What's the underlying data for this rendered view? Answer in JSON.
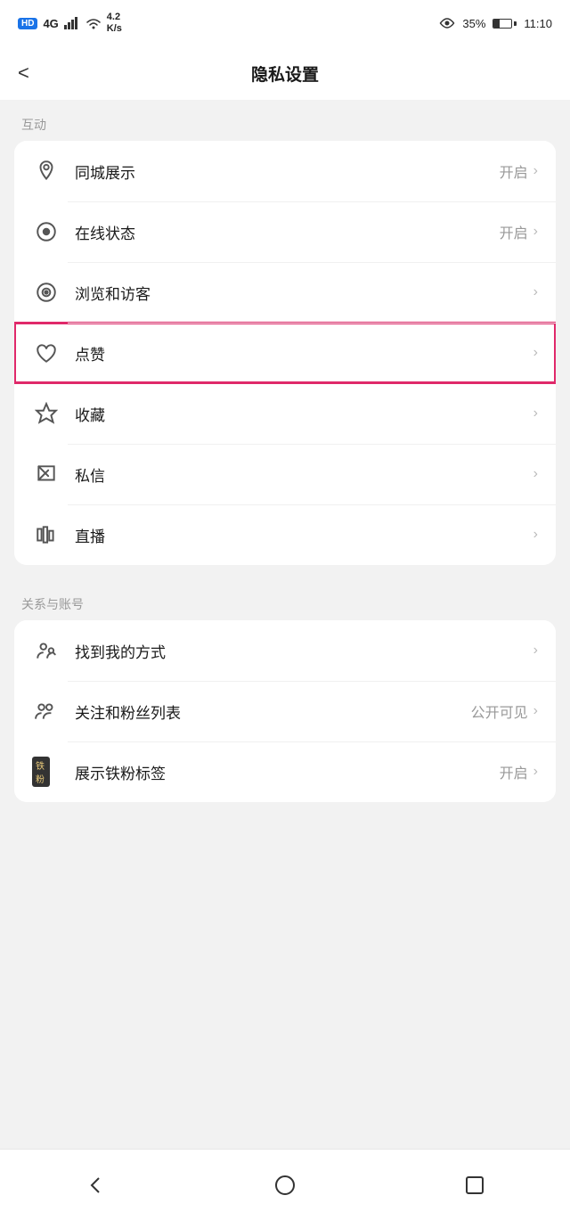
{
  "statusBar": {
    "hd": "HD",
    "signal": "4G",
    "network": "4.2\nK/s",
    "eye": "35%",
    "time": "11:10"
  },
  "topNav": {
    "backLabel": "<",
    "title": "隐私设置"
  },
  "sections": [
    {
      "label": "互动",
      "items": [
        {
          "id": "tongcheng",
          "icon": "location",
          "text": "同城展示",
          "value": "开启",
          "chevron": true,
          "highlighted": false
        },
        {
          "id": "zaixian",
          "icon": "online",
          "text": "在线状态",
          "value": "开启",
          "chevron": true,
          "highlighted": false
        },
        {
          "id": "liulan",
          "icon": "browse",
          "text": "浏览和访客",
          "value": "",
          "chevron": true,
          "highlighted": false
        },
        {
          "id": "dianzan",
          "icon": "like",
          "text": "点赞",
          "value": "",
          "chevron": true,
          "highlighted": true
        },
        {
          "id": "shoucang",
          "icon": "star",
          "text": "收藏",
          "value": "",
          "chevron": true,
          "highlighted": false
        },
        {
          "id": "sixin",
          "icon": "message",
          "text": "私信",
          "value": "",
          "chevron": true,
          "highlighted": false
        },
        {
          "id": "zhibo",
          "icon": "live",
          "text": "直播",
          "value": "",
          "chevron": true,
          "highlighted": false
        }
      ]
    },
    {
      "label": "关系与账号",
      "items": [
        {
          "id": "zhaodao",
          "icon": "findme",
          "text": "找到我的方式",
          "value": "",
          "chevron": true,
          "highlighted": false
        },
        {
          "id": "guanzhu",
          "icon": "follow",
          "text": "关注和粉丝列表",
          "value": "公开可见",
          "chevron": true,
          "highlighted": false
        },
        {
          "id": "tiefan",
          "icon": "tiefan",
          "text": "展示铁粉标签",
          "value": "开启",
          "chevron": true,
          "highlighted": false
        }
      ]
    }
  ],
  "bottomNav": {
    "back": "back",
    "home": "home",
    "square": "square"
  }
}
